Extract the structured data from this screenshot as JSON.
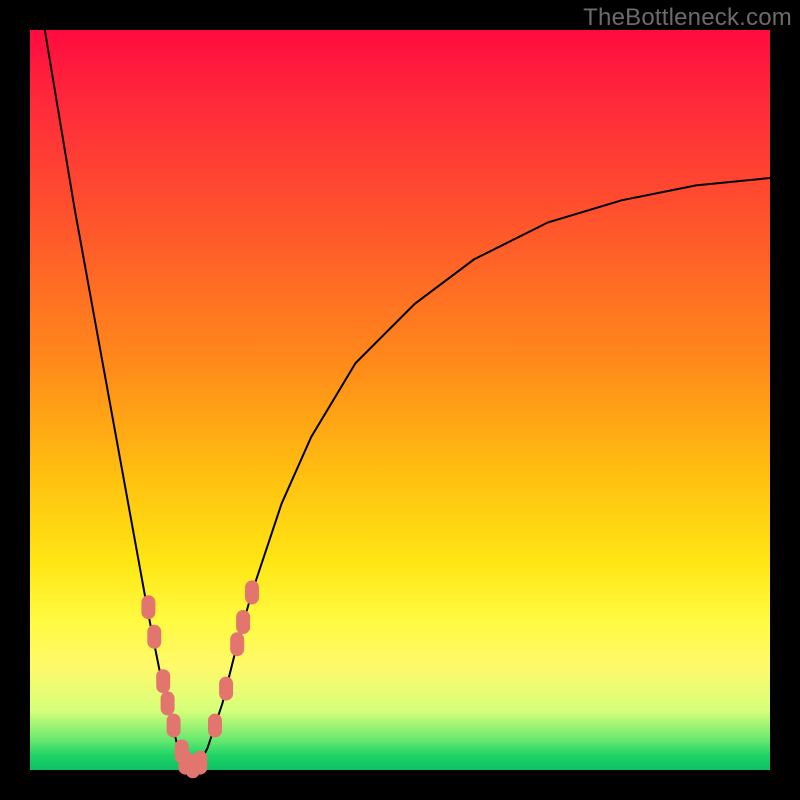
{
  "watermark": "TheBottleneck.com",
  "gradient": {
    "top": "#ff0b3f",
    "mid_upper": "#ff8a1a",
    "mid_lower": "#ffe614",
    "bottom": "#0fbf63"
  },
  "chart_data": {
    "type": "line",
    "title": "",
    "xlabel": "",
    "ylabel": "",
    "xlim": [
      0,
      100
    ],
    "ylim": [
      0,
      100
    ],
    "series": [
      {
        "name": "bottleneck-curve",
        "x": [
          2,
          4,
          6,
          8,
          10,
          12,
          14,
          16,
          18,
          20,
          21,
          22,
          23,
          24,
          26,
          28,
          30,
          34,
          38,
          44,
          52,
          60,
          70,
          80,
          90,
          100
        ],
        "y": [
          100,
          88,
          76,
          65,
          54,
          43,
          32,
          21,
          11,
          3,
          1,
          0,
          1,
          3,
          9,
          17,
          24,
          36,
          45,
          55,
          63,
          69,
          74,
          77,
          79,
          80
        ]
      }
    ],
    "markers": {
      "name": "highlight-dots",
      "points": [
        {
          "x": 16.0,
          "y": 22
        },
        {
          "x": 16.8,
          "y": 18
        },
        {
          "x": 18.0,
          "y": 12
        },
        {
          "x": 18.6,
          "y": 9
        },
        {
          "x": 19.4,
          "y": 6
        },
        {
          "x": 20.5,
          "y": 2.5
        },
        {
          "x": 21.0,
          "y": 1.0
        },
        {
          "x": 22.0,
          "y": 0.5
        },
        {
          "x": 23.0,
          "y": 1.0
        },
        {
          "x": 25.0,
          "y": 6
        },
        {
          "x": 26.5,
          "y": 11
        },
        {
          "x": 28.0,
          "y": 17
        },
        {
          "x": 28.8,
          "y": 20
        },
        {
          "x": 30.0,
          "y": 24
        }
      ]
    }
  }
}
